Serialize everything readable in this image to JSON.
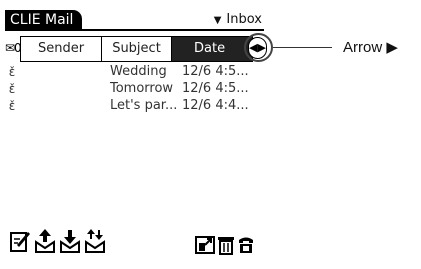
{
  "app": {
    "title": "CLIE Mail",
    "folder": "Inbox"
  },
  "columns": {
    "sender": "Sender",
    "subject": "Subject",
    "date": "Date"
  },
  "header_icons": "✉0",
  "messages": [
    {
      "mark": "ɛ̌",
      "subject": "Wedding",
      "date": "12/6 4:5..."
    },
    {
      "mark": "ɛ̌",
      "subject": "Tomorrow",
      "date": "12/6 4:5..."
    },
    {
      "mark": "ɛ̌",
      "subject": "Let's par...",
      "date": "12/6 4:4..."
    }
  ],
  "callout": {
    "label": "Arrow ▶"
  },
  "toolbar": {
    "icons": [
      "new-mail-icon",
      "send-icon",
      "receive-icon",
      "send-receive-icon",
      "select-icon",
      "trash-icon",
      "phone-icon"
    ]
  }
}
